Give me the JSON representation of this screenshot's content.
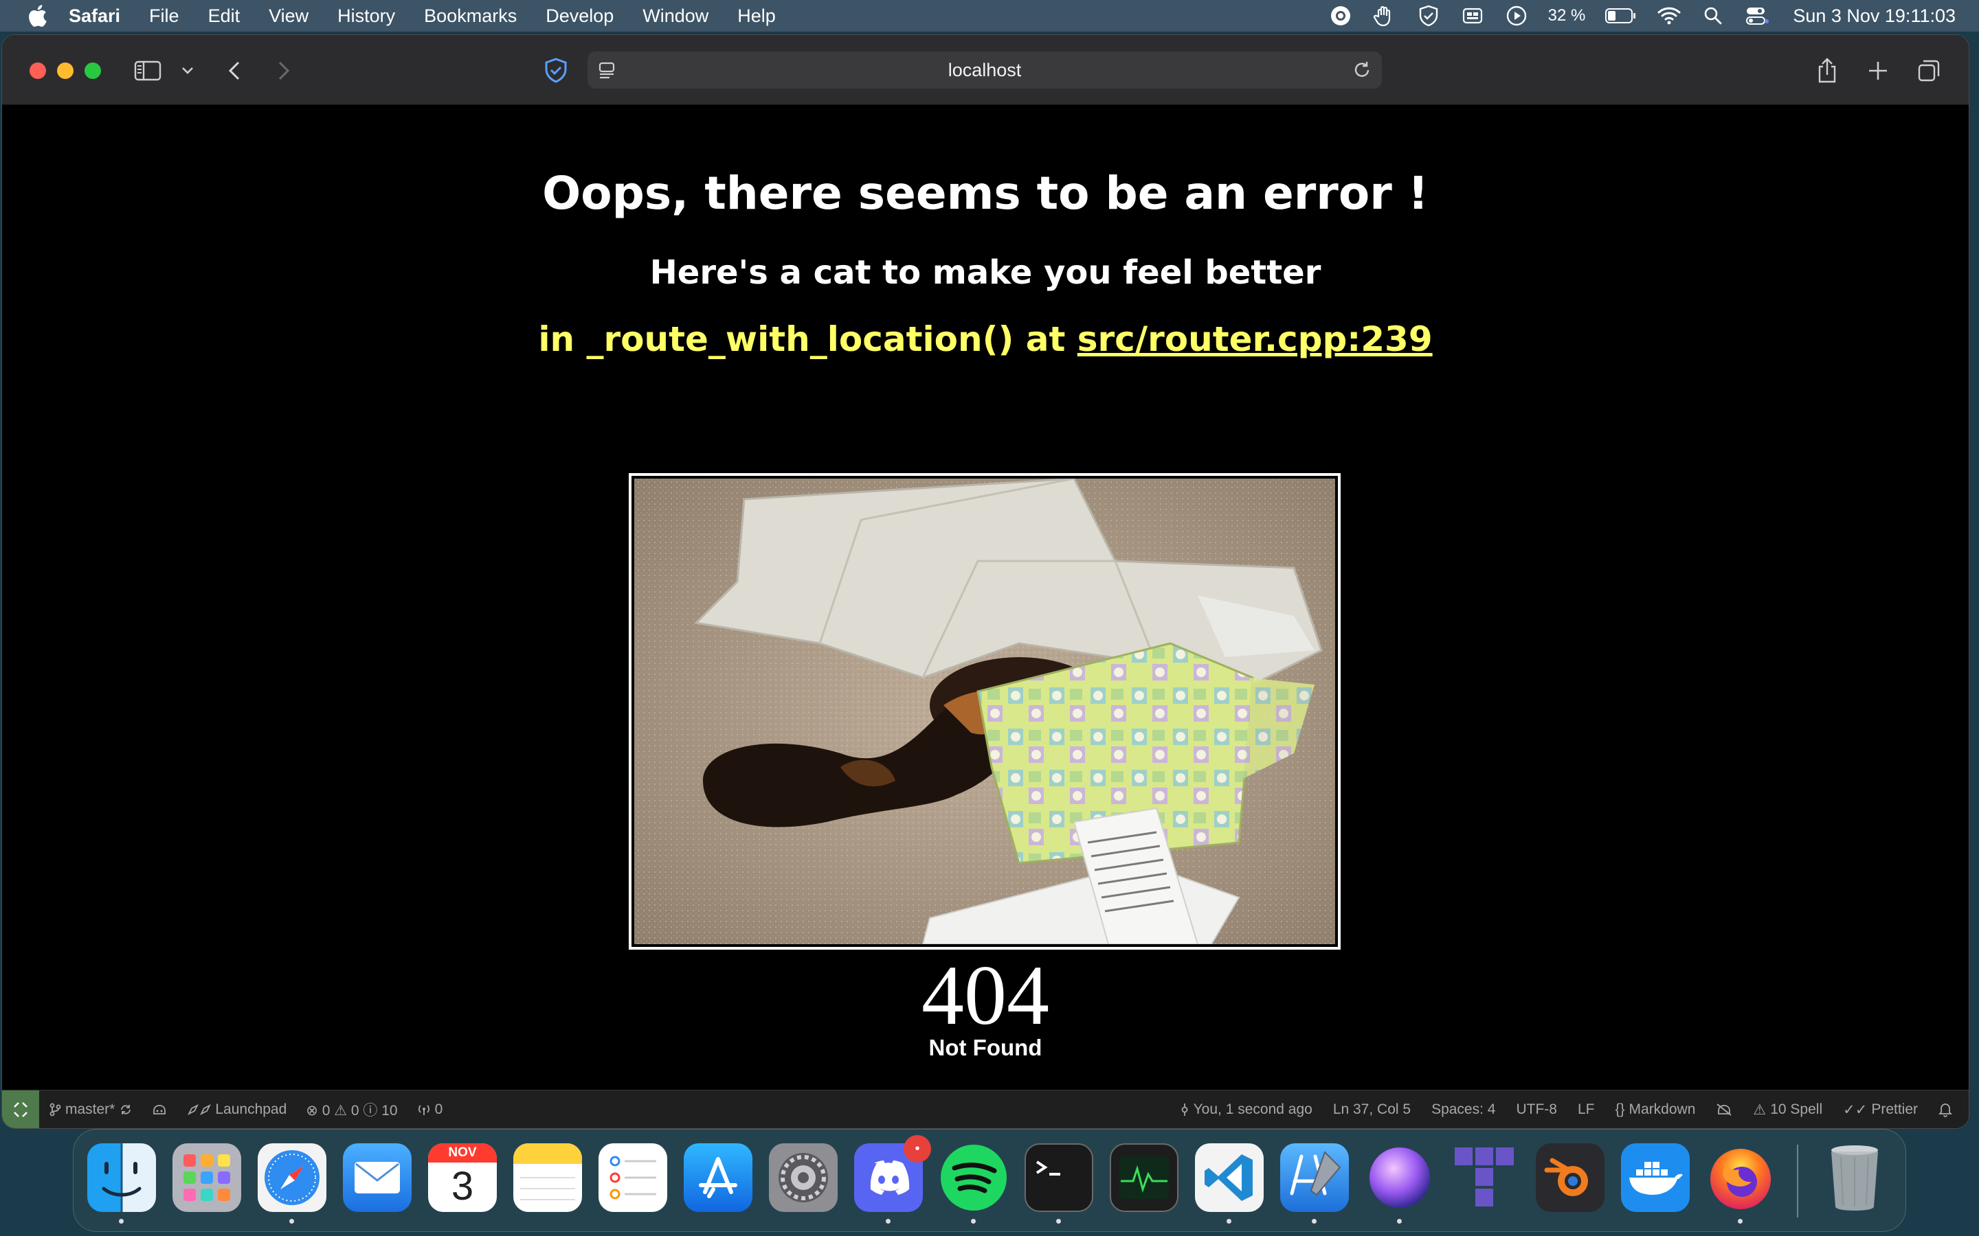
{
  "menubar": {
    "app_name": "Safari",
    "items": [
      "File",
      "Edit",
      "View",
      "History",
      "Bookmarks",
      "Develop",
      "Window",
      "Help"
    ],
    "battery": "32 %",
    "clock": "Sun 3 Nov  19:11:03"
  },
  "browser": {
    "address": "localhost"
  },
  "page": {
    "title": "Oops, there seems to be an error !",
    "subtitle": "Here's a cat to make you feel better",
    "location_prefix": "in _route_with_location() at ",
    "location_link": "src/router.cpp:239",
    "status_code": "404",
    "status_text": "Not Found"
  },
  "statusbar": {
    "branch": "master*",
    "launchpad": "Launchpad",
    "problems": "⊗ 0 ⚠ 0 ⓘ 10",
    "ports": "0",
    "blame": "You, 1 second ago",
    "cursor": "Ln 37, Col 5",
    "spaces": "Spaces: 4",
    "encoding": "UTF-8",
    "eol": "LF",
    "language": "Markdown",
    "spell": "10 Spell",
    "prettier": "Prettier"
  },
  "dock": {
    "apps": [
      "finder",
      "launchpad",
      "safari",
      "mail",
      "calendar",
      "notes",
      "reminders",
      "app-store",
      "system-settings",
      "discord",
      "spotify",
      "terminal",
      "activity-monitor",
      "vscode",
      "xcode",
      "siri",
      "tableplus",
      "blender",
      "docker",
      "firefox",
      "trash"
    ],
    "calendar_month": "NOV",
    "calendar_day": "3",
    "discord_badge": "•"
  }
}
